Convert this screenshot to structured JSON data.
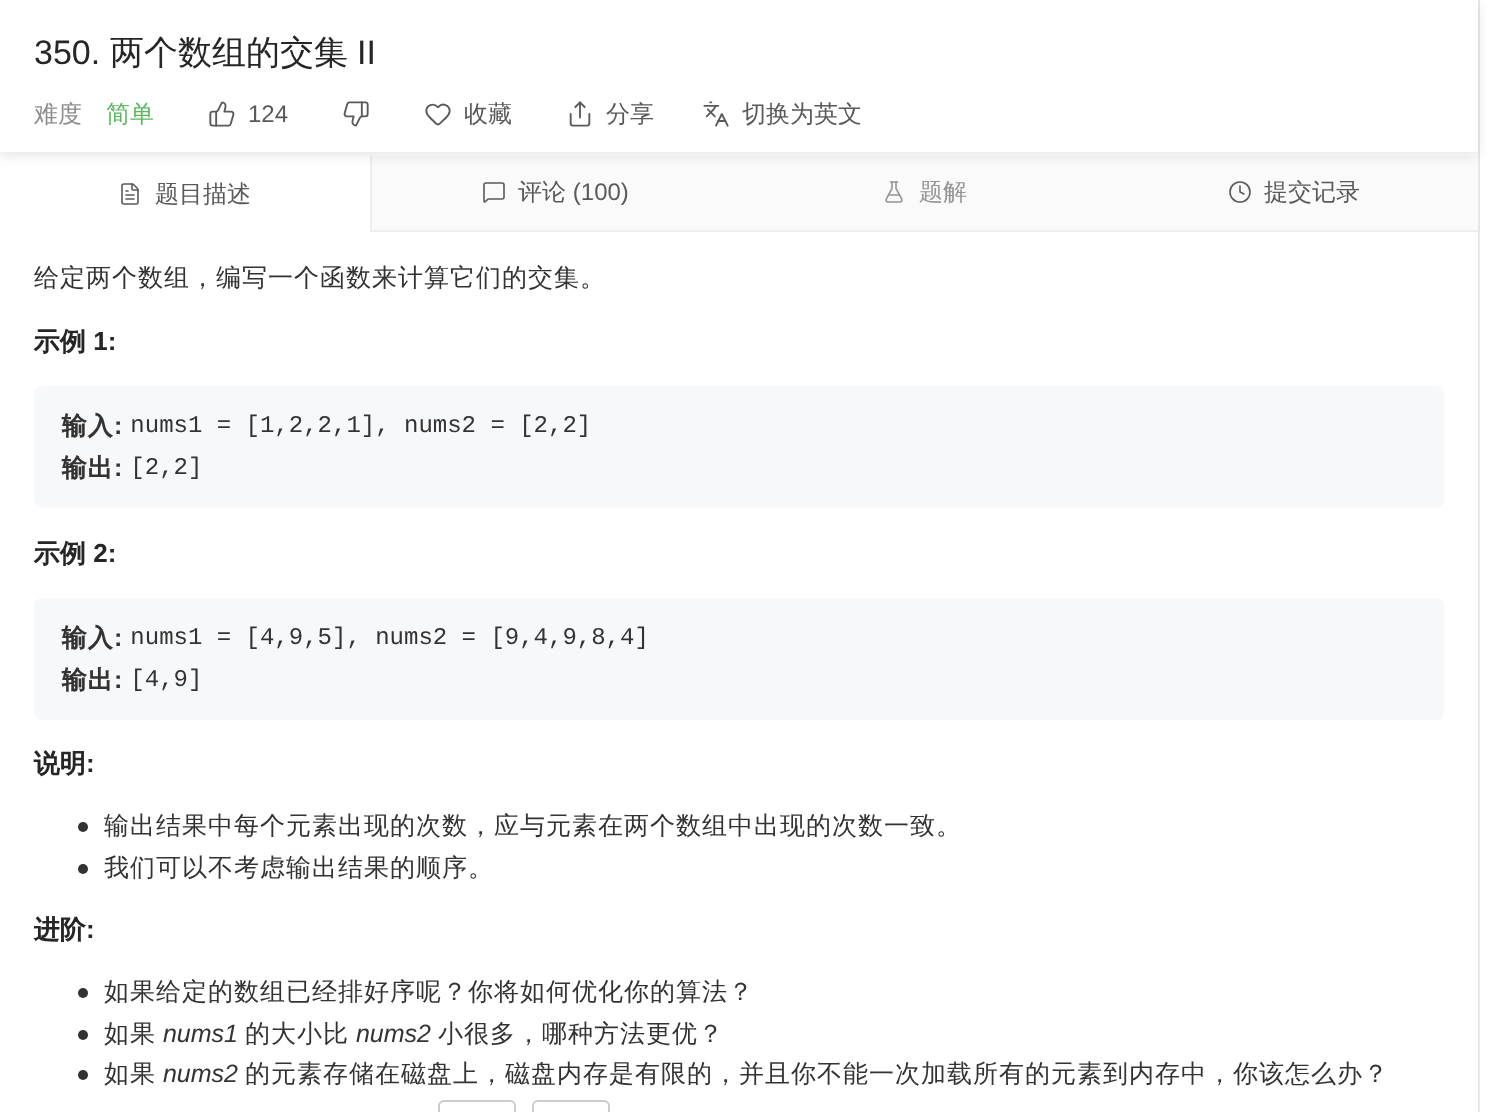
{
  "problem": {
    "title": "350. 两个数组的交集 II",
    "difficulty_label": "难度",
    "difficulty": "简单",
    "actions": [
      {
        "kind": "like",
        "label": "124"
      },
      {
        "kind": "dislike"
      },
      {
        "kind": "favorite",
        "label": "收藏"
      },
      {
        "kind": "share",
        "label": "分享"
      },
      {
        "kind": "translate",
        "label": "切换为英文"
      }
    ]
  },
  "tabs": [
    {
      "kind": "description",
      "label": "题目描述",
      "selected": true,
      "disabled": false
    },
    {
      "kind": "comments",
      "label": "评论 (100)",
      "selected": false,
      "disabled": false
    },
    {
      "kind": "solutions",
      "label": "题解",
      "selected": false,
      "disabled": true
    },
    {
      "kind": "submissions",
      "label": "提交记录",
      "selected": false,
      "disabled": false
    }
  ],
  "description": "给定两个数组，编写一个函数来计算它们的交集。",
  "examples": [
    {
      "heading": "示例 1:",
      "lines": [
        {
          "label": "输入:",
          "value": "nums1 = [1,2,2,1], nums2 = [2,2]"
        },
        {
          "label": "输出:",
          "value": "[2,2]"
        }
      ]
    },
    {
      "heading": "示例 2:",
      "lines": [
        {
          "label": "输入:",
          "value": "nums1 = [4,9,5], nums2 = [9,4,9,8,4]"
        },
        {
          "label": "输出:",
          "value": "[4,9]"
        }
      ]
    }
  ],
  "notes": {
    "heading": "说明:",
    "items": [
      "输出结果中每个元素出现的次数，应与元素在两个数组中出现的次数一致。",
      "我们可以不考虑输出结果的顺序。"
    ]
  },
  "follow_up": {
    "heading": "进阶:",
    "items": [
      "如果给定的数组已经排好序呢？你将如何优化你的算法？",
      "如果 *nums1* 的大小比 *nums2* 小很多，哪种方法更优？",
      "如果 *nums2* 的元素存储在磁盘上，磁盘内存是有限的，并且你不能一次加载所有的元素到内存中，你该怎么办？"
    ]
  }
}
